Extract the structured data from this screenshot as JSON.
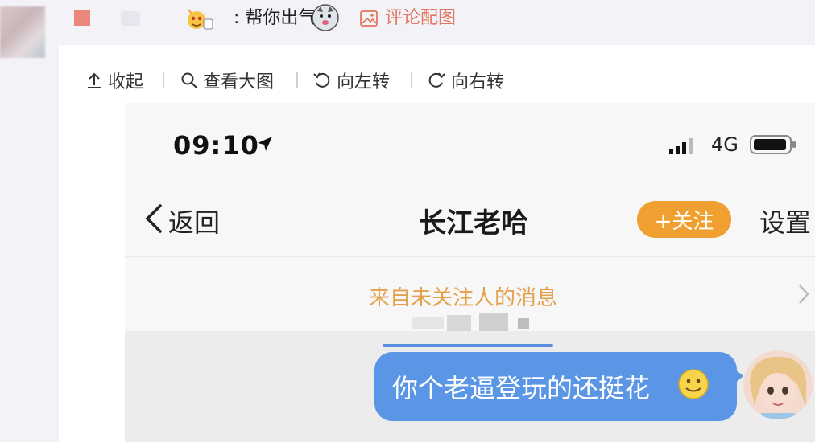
{
  "comment": {
    "text": "帮你出气",
    "attachment_label": "评论配图",
    "attachment_icon": "image-icon"
  },
  "toolbar": {
    "items": [
      {
        "label": "收起",
        "icon": "upload-arrow-icon"
      },
      {
        "label": "查看大图",
        "icon": "magnifier-icon"
      },
      {
        "label": "向左转",
        "icon": "rotate-left-icon"
      },
      {
        "label": "向右转",
        "icon": "rotate-right-icon"
      }
    ]
  },
  "phone": {
    "status": {
      "time": "09:10",
      "network": "4G"
    },
    "nav": {
      "back_label": "返回",
      "title": "长江老哈",
      "follow_label": "+关注",
      "settings_label": "设置"
    },
    "stranger_notice": "来自未关注人的消息",
    "message": {
      "text": "你个老逼登玩的还挺花"
    }
  },
  "colors": {
    "accent_orange": "#f0a030",
    "bubble_blue": "#5b96e6",
    "notice_text": "#e4a04a",
    "link_red": "#e47560"
  }
}
